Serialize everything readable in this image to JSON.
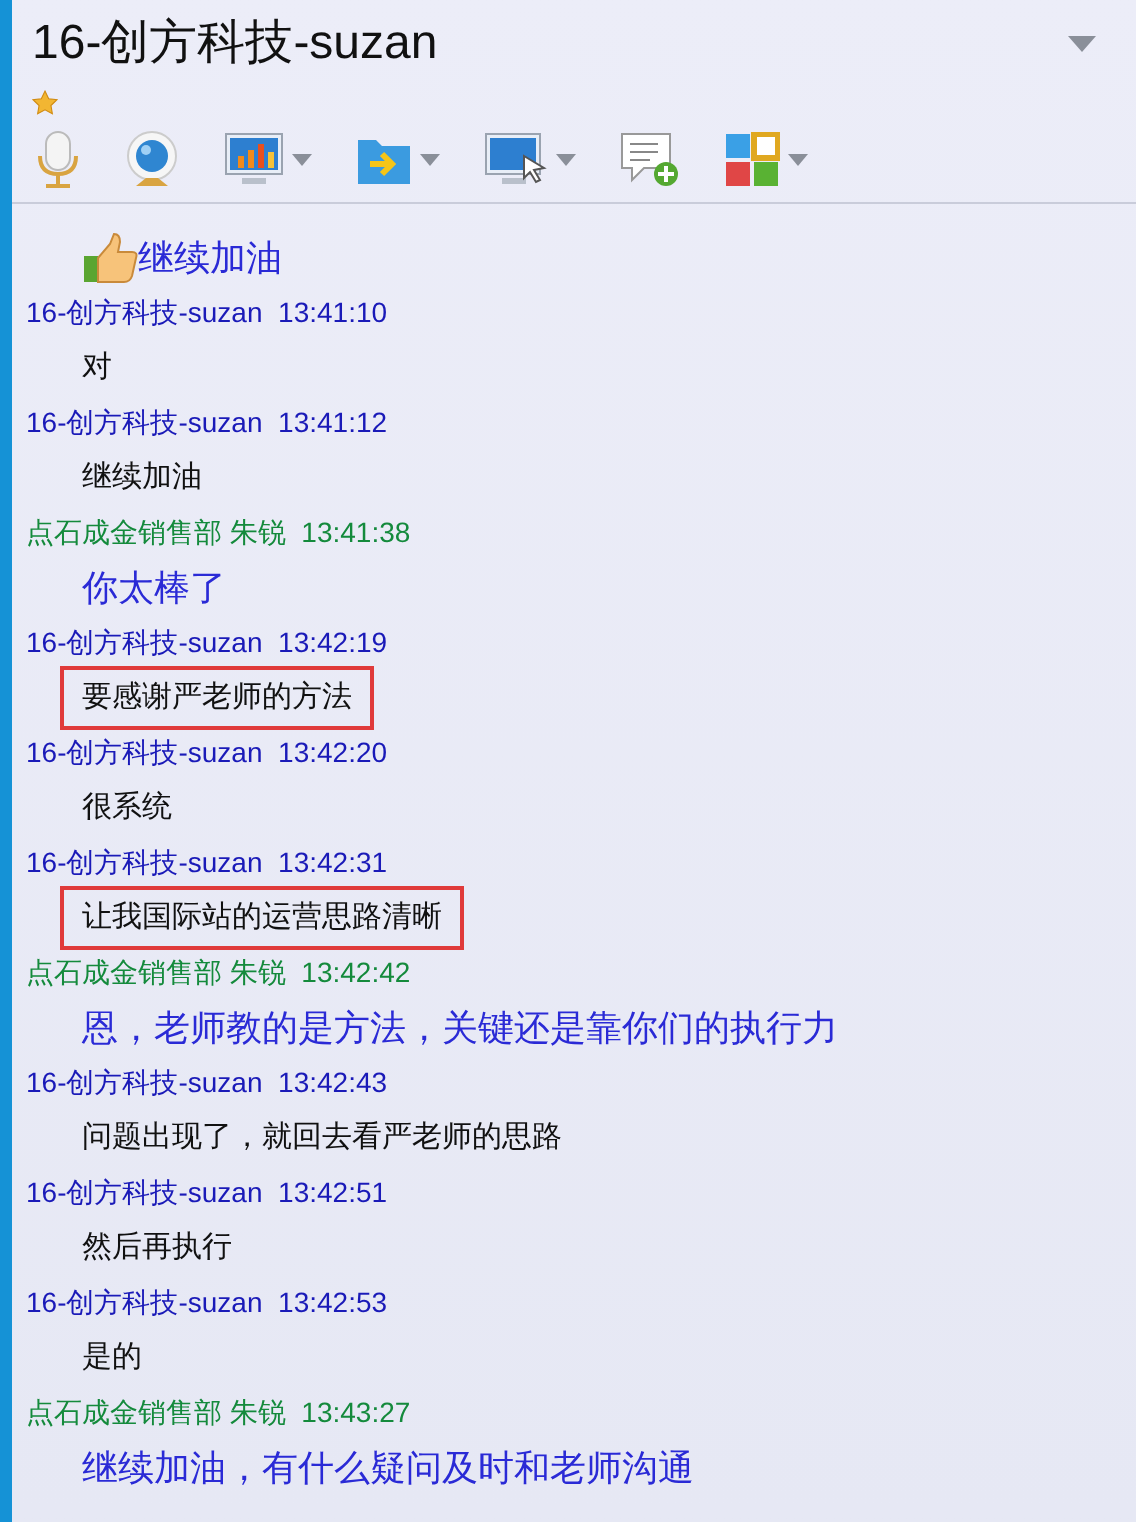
{
  "window": {
    "title": "16-创方科技-suzan",
    "starred": true
  },
  "toolbar": [
    {
      "kind": "mic",
      "dropdown": false
    },
    {
      "kind": "camera",
      "dropdown": false
    },
    {
      "kind": "chart",
      "dropdown": true
    },
    {
      "kind": "folder",
      "dropdown": true
    },
    {
      "kind": "screen",
      "dropdown": true
    },
    {
      "kind": "chat",
      "dropdown": false
    },
    {
      "kind": "apps",
      "dropdown": true
    }
  ],
  "messages": [
    {
      "kind": "other",
      "body": "继续加油",
      "emoji": true,
      "highlighted": false
    },
    {
      "kind": "self",
      "sender": "16-创方科技-suzan",
      "time": "13:41:10",
      "body": "对",
      "emoji": false,
      "highlighted": false
    },
    {
      "kind": "self",
      "sender": "16-创方科技-suzan",
      "time": "13:41:12",
      "body": "继续加油",
      "emoji": false,
      "highlighted": false
    },
    {
      "kind": "other",
      "sender": "点石成金销售部 朱锐",
      "time": "13:41:38",
      "body": "你太棒了",
      "emoji": false,
      "highlighted": false
    },
    {
      "kind": "self",
      "sender": "16-创方科技-suzan",
      "time": "13:42:19",
      "body": "要感谢严老师的方法",
      "emoji": false,
      "highlighted": true
    },
    {
      "kind": "self",
      "sender": "16-创方科技-suzan",
      "time": "13:42:20",
      "body": "很系统",
      "emoji": false,
      "highlighted": false
    },
    {
      "kind": "self",
      "sender": "16-创方科技-suzan",
      "time": "13:42:31",
      "body": "让我国际站的运营思路清晰",
      "emoji": false,
      "highlighted": true
    },
    {
      "kind": "other",
      "sender": "点石成金销售部 朱锐",
      "time": "13:42:42",
      "body": "恩，老师教的是方法，关键还是靠你们的执行力",
      "emoji": false,
      "highlighted": false
    },
    {
      "kind": "self",
      "sender": "16-创方科技-suzan",
      "time": "13:42:43",
      "body": "问题出现了，就回去看严老师的思路",
      "emoji": false,
      "highlighted": false
    },
    {
      "kind": "self",
      "sender": "16-创方科技-suzan",
      "time": "13:42:51",
      "body": "然后再执行",
      "emoji": false,
      "highlighted": false
    },
    {
      "kind": "self",
      "sender": "16-创方科技-suzan",
      "time": "13:42:53",
      "body": "是的",
      "emoji": false,
      "highlighted": false
    },
    {
      "kind": "other",
      "sender": "点石成金销售部 朱锐",
      "time": "13:43:27",
      "body": "继续加油，有什么疑问及时和老师沟通",
      "emoji": false,
      "highlighted": false
    }
  ]
}
